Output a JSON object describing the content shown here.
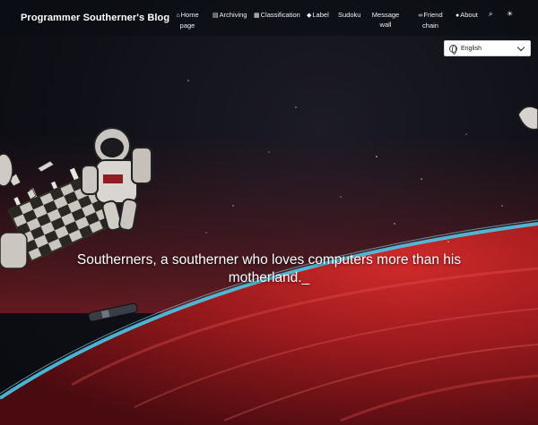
{
  "navbar": {
    "brand": "Programmer Southerner's Blog",
    "items": [
      {
        "label": "Home page",
        "icon": "home-icon"
      },
      {
        "label": "Archiving",
        "icon": "archive-icon"
      },
      {
        "label": "Classification",
        "icon": "grid-icon"
      },
      {
        "label": "Label",
        "icon": "tag-icon"
      },
      {
        "label": "Sudoku",
        "icon": ""
      },
      {
        "label": "Message wall",
        "icon": ""
      },
      {
        "label": "Friend chain",
        "icon": "link-icon"
      },
      {
        "label": "About",
        "icon": "user-icon"
      }
    ],
    "search_icon": "search-icon",
    "theme_icon": "sun-icon"
  },
  "language": {
    "selected": "English"
  },
  "hero": {
    "tagline": "Southerners, a southerner who loves computers more than his motherland._"
  },
  "colors": {
    "accent_planet": "#b3201f",
    "atmosphere": "#3fb8d8",
    "space": "#0f1017"
  }
}
